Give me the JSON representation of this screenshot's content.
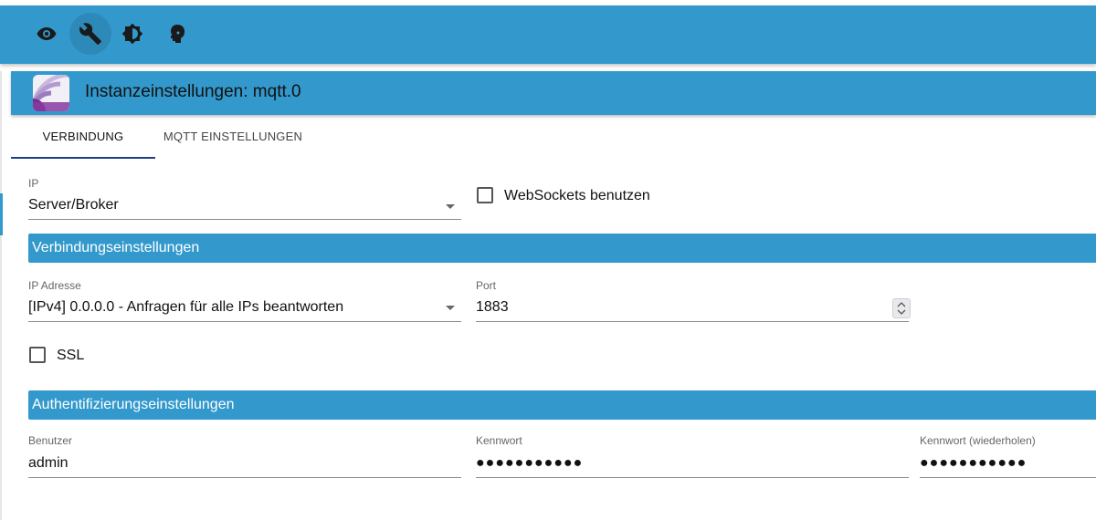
{
  "toolbar": {
    "icons": [
      "eye-icon",
      "wrench-icon",
      "brightness-icon",
      "expert-head-icon"
    ],
    "active": "wrench-icon"
  },
  "dialog": {
    "title": "Instanzeinstellungen: mqtt.0",
    "logo": "mqtt-logo"
  },
  "tabs": [
    {
      "label": "Verbindung",
      "active": true
    },
    {
      "label": "MQTT Einstellungen",
      "active": false
    }
  ],
  "connection": {
    "ip_label": "IP",
    "ip_value": "Server/Broker",
    "websockets_label": "WebSockets benutzen",
    "websockets_checked": false
  },
  "connection_settings": {
    "section_title": "Verbindungseinstellungen",
    "ip_address_label": "IP Adresse",
    "ip_address_value": "[IPv4] 0.0.0.0 - Anfragen für alle IPs beantworten",
    "port_label": "Port",
    "port_value": "1883",
    "ssl_label": "SSL",
    "ssl_checked": false
  },
  "auth_settings": {
    "section_title": "Authentifizierungseinstellungen",
    "user_label": "Benutzer",
    "user_value": "admin",
    "password_label": "Kennwort",
    "password_value": "●●●●●●●●●●●",
    "password_repeat_label": "Kennwort (wiederholen)",
    "password_repeat_value": "●●●●●●●●●●●"
  },
  "colors": {
    "accent": "#3399cc",
    "tab_indicator": "#1d3f8a"
  }
}
